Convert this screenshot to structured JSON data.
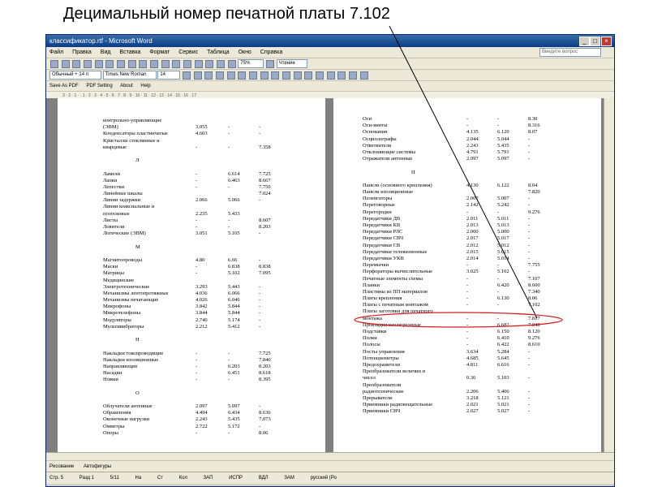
{
  "slide_title": "Децимальный номер печатной платы 7.102",
  "window": {
    "title": "классификатор.rtf - Microsoft Word",
    "controls": [
      "_",
      "□",
      "×"
    ]
  },
  "menu": {
    "items": [
      "Файл",
      "Правка",
      "Вид",
      "Вставка",
      "Формат",
      "Сервис",
      "Таблица",
      "Окно",
      "Справка"
    ],
    "help_placeholder": "Введите вопрос"
  },
  "toolbar": {
    "zoom": "75%",
    "reading": "Чтение",
    "style": "Обычный + 14 п",
    "font": "Times New Roman",
    "size": "14"
  },
  "pdfbar": {
    "items": [
      "Save As PDF",
      "PDF Setting",
      "About",
      "Help"
    ]
  },
  "ruler_text": "3 · 2 · 1 · · 1 · 2 · 3 · 4 · 5 · 6 · 7 · 8 · 9 · 10 · 11 · 12 · 13 · 14 · 15 · 16 · 17",
  "left_page": [
    {
      "n": "контрольно-управляющие",
      "c1": "",
      "c2": "",
      "c3": ""
    },
    {
      "n": "(ЭВМ)",
      "c1": "3.055",
      "c2": "-",
      "c3": "-"
    },
    {
      "n": "Конденсаторы пластинчатые",
      "c1": "4.603",
      "c2": "-",
      "c3": "-"
    },
    {
      "n": "Кристаллы стеклянные и",
      "c1": "",
      "c2": "",
      "c3": ""
    },
    {
      "n": "кварцевые",
      "c1": "-",
      "c2": "-",
      "c3": "7.358"
    },
    {
      "n": "",
      "c1": "",
      "c2": "",
      "c3": ""
    },
    {
      "n": "Л",
      "c1": "",
      "c2": "",
      "c3": "",
      "letter": true
    },
    {
      "n": "",
      "c1": "",
      "c2": "",
      "c3": ""
    },
    {
      "n": "Ламели",
      "c1": "-",
      "c2": "6.614",
      "c3": "7.725"
    },
    {
      "n": "Лапки",
      "c1": "-",
      "c2": "6.463",
      "c3": "8.667"
    },
    {
      "n": "Лепестки",
      "c1": "-",
      "c2": "-",
      "c3": "7.750"
    },
    {
      "n": "Линейные шкалы",
      "c1": "",
      "c2": "",
      "c3": "7.024"
    },
    {
      "n": "Линии задержки",
      "c1": "2.066",
      "c2": "5.066",
      "c3": "-"
    },
    {
      "n": "Линии коаксиальные и",
      "c1": "",
      "c2": "",
      "c3": ""
    },
    {
      "n": "полосковые",
      "c1": "2.235",
      "c2": "5.433",
      "c3": ""
    },
    {
      "n": "Листы",
      "c1": "-",
      "c2": "-",
      "c3": "8.607"
    },
    {
      "n": "Ловители",
      "c1": "-",
      "c2": "-",
      "c3": "8.203"
    },
    {
      "n": "Логические (ЭВМ)",
      "c1": "3.051",
      "c2": "5.105",
      "c3": "-"
    },
    {
      "n": "",
      "c1": "",
      "c2": "",
      "c3": ""
    },
    {
      "n": "М",
      "c1": "",
      "c2": "",
      "c3": "",
      "letter": true
    },
    {
      "n": "",
      "c1": "",
      "c2": "",
      "c3": ""
    },
    {
      "n": "Магнитопроводы",
      "c1": "4.80",
      "c2": "6.66",
      "c3": "-"
    },
    {
      "n": "Маски",
      "c1": "-",
      "c2": "6.838",
      "c3": "8.838"
    },
    {
      "n": "Матрицы",
      "c1": "-",
      "c2": "5.102",
      "c3": "7.095"
    },
    {
      "n": "Медицинские",
      "c1": "",
      "c2": "",
      "c3": ""
    },
    {
      "n": "Электротехнические",
      "c1": "3.293",
      "c2": "5.443",
      "c3": "-"
    },
    {
      "n": "Механизмы лентопротяжные",
      "c1": "4.036",
      "c2": "6.066",
      "c3": "-"
    },
    {
      "n": "Механизмы печатающие",
      "c1": "4.026",
      "c2": "6.046",
      "c3": "-"
    },
    {
      "n": "Микрофоны",
      "c1": "3.842",
      "c2": "5.844",
      "c3": "-"
    },
    {
      "n": "Микротелефоны",
      "c1": "3.844",
      "c2": "5.844",
      "c3": "-"
    },
    {
      "n": "Модуляторы",
      "c1": "2.740",
      "c2": "5.174",
      "c3": "-"
    },
    {
      "n": "Мультивибраторы",
      "c1": "2.212",
      "c2": "5.412",
      "c3": "-"
    },
    {
      "n": "",
      "c1": "",
      "c2": "",
      "c3": ""
    },
    {
      "n": "Н",
      "c1": "",
      "c2": "",
      "c3": "",
      "letter": true
    },
    {
      "n": "",
      "c1": "",
      "c2": "",
      "c3": ""
    },
    {
      "n": "Накладки токопроводящие",
      "c1": "-",
      "c2": "-",
      "c3": "7.725"
    },
    {
      "n": "Накладки изоляционные",
      "c1": "-",
      "c2": "-",
      "c3": "7.840"
    },
    {
      "n": "Направляющие",
      "c1": "-",
      "c2": "6.203",
      "c3": "8.203"
    },
    {
      "n": "Насадки",
      "c1": "-",
      "c2": "6.451",
      "c3": "8.618"
    },
    {
      "n": "Ножки",
      "c1": "-",
      "c2": "-",
      "c3": "8.395"
    },
    {
      "n": "",
      "c1": "",
      "c2": "",
      "c3": ""
    },
    {
      "n": "О",
      "c1": "",
      "c2": "",
      "c3": "",
      "letter": true
    },
    {
      "n": "",
      "c1": "",
      "c2": "",
      "c3": ""
    },
    {
      "n": "Облучатели антенные",
      "c1": "2.097",
      "c2": "5.097",
      "c3": "-"
    },
    {
      "n": "Обрамления",
      "c1": "4.494",
      "c2": "6.434",
      "c3": "8.636"
    },
    {
      "n": "Оконечные нагрузки",
      "c1": "2.243",
      "c2": "5.435",
      "c3": "7.073"
    },
    {
      "n": "Омметры",
      "c1": "2.722",
      "c2": "5.172",
      "c3": "-"
    },
    {
      "n": "Опоры",
      "c1": "-",
      "c2": "-",
      "c3": "8.06"
    }
  ],
  "right_page": [
    {
      "n": "Оси",
      "c1": "-",
      "c2": "-",
      "c3": "8.30"
    },
    {
      "n": "Оси-винты",
      "c1": "-",
      "c2": "-",
      "c3": "8.316"
    },
    {
      "n": "Основания",
      "c1": "4.135",
      "c2": "6.120",
      "c3": "8.07"
    },
    {
      "n": "Осциллографы",
      "c1": "2.044",
      "c2": "5.044",
      "c3": "-"
    },
    {
      "n": "Ответвители",
      "c1": "2.243",
      "c2": "5.435",
      "c3": "-"
    },
    {
      "n": "Отклоняющие системы",
      "c1": "4.791",
      "c2": "5.791",
      "c3": "-"
    },
    {
      "n": "Отражатели антенные",
      "c1": "2.097",
      "c2": "5.097",
      "c3": "-"
    },
    {
      "n": "",
      "c1": "",
      "c2": "",
      "c3": ""
    },
    {
      "n": "П",
      "c1": "",
      "c2": "",
      "c3": "",
      "letter": true
    },
    {
      "n": "",
      "c1": "",
      "c2": "",
      "c3": ""
    },
    {
      "n": "Панели (основного крепления)",
      "c1": "4.130",
      "c2": "6.122",
      "c3": "8.04"
    },
    {
      "n": "Панели изоляционные",
      "c1": "",
      "c2": "",
      "c3": "7.820"
    },
    {
      "n": "Пеленгаторы",
      "c1": "2.007",
      "c2": "5.007",
      "c3": "-"
    },
    {
      "n": "Переговорные",
      "c1": "2.142",
      "c2": "5.242",
      "c3": "-"
    },
    {
      "n": "Перегородки",
      "c1": "-",
      "c2": "-",
      "c3": "9.276"
    },
    {
      "n": "Передатчики ДВ",
      "c1": "2.011",
      "c2": "5.011",
      "c3": "-"
    },
    {
      "n": "Передатчики КВ",
      "c1": "2.013",
      "c2": "5.013",
      "c3": "-"
    },
    {
      "n": "Передатчики РЛС",
      "c1": "2.000",
      "c2": "5.000",
      "c3": "-"
    },
    {
      "n": "Передатчики СВЧ",
      "c1": "2.017",
      "c2": "5.017",
      "c3": "-"
    },
    {
      "n": "Передатчики СВ",
      "c1": "2.012",
      "c2": "5.012",
      "c3": "-"
    },
    {
      "n": "Передатчики телевизионные",
      "c1": "2.015",
      "c2": "5.015",
      "c3": "-"
    },
    {
      "n": "Передатчики УКВ",
      "c1": "2.014",
      "c2": "5.014",
      "c3": "-"
    },
    {
      "n": "Перемычки",
      "c1": "-",
      "c2": "-",
      "c3": "7.755"
    },
    {
      "n": "Перфораторы вычислительные",
      "c1": "3.025",
      "c2": "5.102",
      "c3": "-"
    },
    {
      "n": "Печатные элементы схемы",
      "c1": "-",
      "c2": "-",
      "c3": "7.107"
    },
    {
      "n": "Планки",
      "c1": "-",
      "c2": "6.420",
      "c3": "8.600"
    },
    {
      "n": "Пластины из ПП материалов",
      "c1": "-",
      "c2": "-",
      "c3": "7.340"
    },
    {
      "n": "Платы крепления",
      "c1": "-",
      "c2": "6.130",
      "c3": "8.06"
    },
    {
      "n": "Платы с печатным монтажом",
      "c1": "-",
      "c2": "-",
      "c3": "7.102"
    },
    {
      "n": "Платы заготовки для печатного",
      "c1": "",
      "c2": "",
      "c3": ""
    },
    {
      "n": "монтажа",
      "c1": "-",
      "c2": "-",
      "c3": "7.817"
    },
    {
      "n": "Прокладки изоляционные",
      "c1": "-",
      "c2": "6.682",
      "c3": "7.840"
    },
    {
      "n": "Подставки",
      "c1": "-",
      "c2": "6.150",
      "c3": "8.120"
    },
    {
      "n": "Полки",
      "c1": "-",
      "c2": "6.410",
      "c3": "9.276"
    },
    {
      "n": "Полосы",
      "c1": "-",
      "c2": "6.422",
      "c3": "8.610"
    },
    {
      "n": "Посты управления",
      "c1": "3.634",
      "c2": "5.284",
      "c3": "-"
    },
    {
      "n": "Потенциометры",
      "c1": "4.685",
      "c2": "5.645",
      "c3": "-"
    },
    {
      "n": "Предохранители",
      "c1": "4.811",
      "c2": "6.616",
      "c3": "-"
    },
    {
      "n": "Преобразователи величин и",
      "c1": "",
      "c2": "",
      "c3": ""
    },
    {
      "n": "чисел",
      "c1": "0.36",
      "c2": "5.103",
      "c3": "-"
    },
    {
      "n": "Преобразователи",
      "c1": "",
      "c2": "",
      "c3": ""
    },
    {
      "n": "радиотехнические",
      "c1": "2.206",
      "c2": "5.406",
      "c3": "-"
    },
    {
      "n": "Прерыватели",
      "c1": "3.218",
      "c2": "5.121",
      "c3": "-"
    },
    {
      "n": "Приемники радиовещательные",
      "c1": "2.021",
      "c2": "5.021",
      "c3": "-"
    },
    {
      "n": "Приемники СВЧ",
      "c1": "2.027",
      "c2": "5.027",
      "c3": "-"
    }
  ],
  "drawbar": {
    "items": [
      "Рисование",
      "Автофигуры"
    ]
  },
  "statusbar": {
    "items": [
      "Стр. 5",
      "Разд 1",
      "5/11",
      "На",
      "Ст",
      "Кол",
      "ЗАП",
      "ИСПР",
      "ВДЛ",
      "ЗАМ",
      "русский (Ро"
    ]
  },
  "highlight": {
    "color": "#d22020",
    "row_index": 28
  }
}
